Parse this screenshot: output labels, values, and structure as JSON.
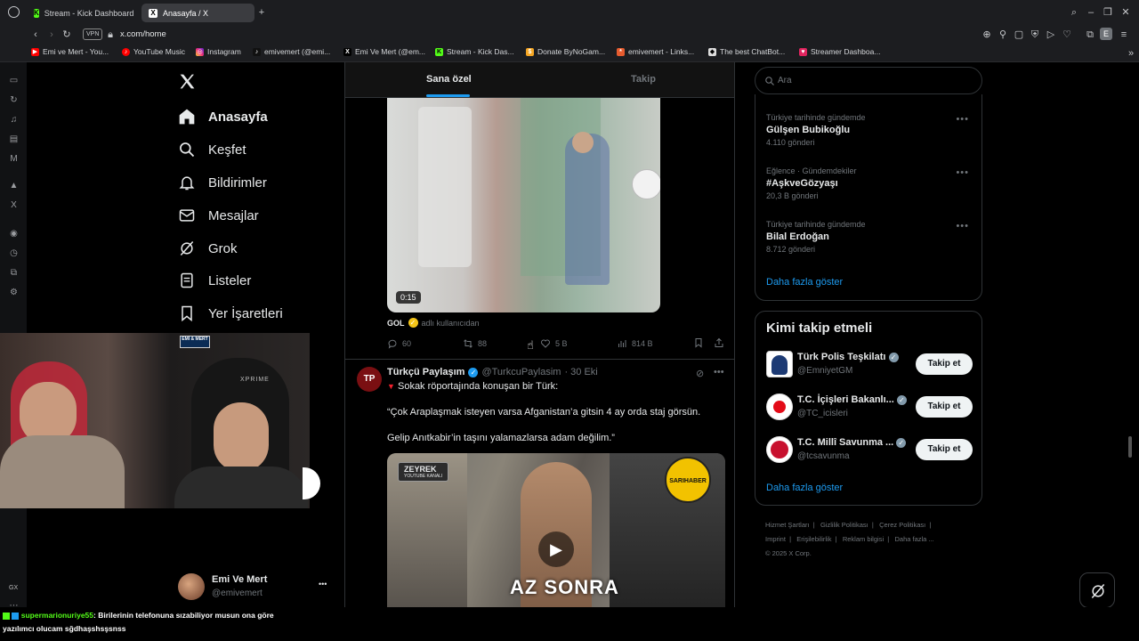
{
  "browser": {
    "tabs": [
      {
        "label": "Stream - Kick Dashboard",
        "active": false,
        "icon": "kick-icon"
      },
      {
        "label": "Anasayfa / X",
        "active": true,
        "icon": "x-icon"
      }
    ],
    "vpn_badge": "VPN",
    "url": "x.com/home",
    "profile_initial": "E",
    "bookmarks": [
      {
        "label": "Emi ve Mert - You...",
        "icon": "youtube-icon"
      },
      {
        "label": "YouTube Music",
        "icon": "youtube-music-icon"
      },
      {
        "label": "Instagram",
        "icon": "instagram-icon"
      },
      {
        "label": "emivemert (@emi...",
        "icon": "tiktok-icon"
      },
      {
        "label": "Emi Ve Mert (@em...",
        "icon": "x-icon"
      },
      {
        "label": "Stream - Kick Das...",
        "icon": "kick-icon"
      },
      {
        "label": "Donate ByNoGam...",
        "icon": "donate-icon"
      },
      {
        "label": "emivemert - Links...",
        "icon": "linktree-icon"
      },
      {
        "label": "The best ChatBot...",
        "icon": "chatbot-icon"
      },
      {
        "label": "Streamer Dashboa...",
        "icon": "dashboard-icon"
      }
    ],
    "rail_label": "GX"
  },
  "nav": {
    "items": [
      {
        "label": "Anasayfa",
        "icon": "home-icon",
        "active": true
      },
      {
        "label": "Keşfet",
        "icon": "search-icon",
        "active": false
      },
      {
        "label": "Bildirimler",
        "icon": "bell-icon",
        "active": false
      },
      {
        "label": "Mesajlar",
        "icon": "mail-icon",
        "active": false
      },
      {
        "label": "Grok",
        "icon": "grok-icon",
        "active": false
      },
      {
        "label": "Listeler",
        "icon": "list-icon",
        "active": false
      },
      {
        "label": "Yer İşaretleri",
        "icon": "bookmark-icon",
        "active": false
      }
    ],
    "account": {
      "name": "Emi Ve Mert",
      "handle": "@emivemert",
      "more": "•••"
    }
  },
  "feed": {
    "tabs": [
      "Sana özel",
      "Takip"
    ],
    "post1": {
      "duration": "0:15",
      "caption_user": "GOL",
      "caption_extra": "adlı kullanıcıdan",
      "replies": "60",
      "reposts": "88",
      "likes": "5 B",
      "views": "814 B"
    },
    "post2": {
      "name": "Türkçü Paylaşım",
      "handle": "@TurkcuPaylasim",
      "date": "· 30 Eki",
      "line1": "Sokak röportajında konuşan bir Türk:",
      "line2": "“Çok Araplaşmak isteyen varsa Afganistan’a gitsin 4 ay orda staj görsün.",
      "line3": "Gelip Anıtkabir’in taşını yalamazlarsa adam değilim.”",
      "video_badge": "ZEYREK",
      "video_badge_sub": "YOUTUBE KANALI",
      "video_logo": "SARIHABER",
      "video_overlay": "AZ SONRA"
    }
  },
  "sidebar": {
    "search_placeholder": "Ara",
    "trends": [
      {
        "category": "Türkiye tarihinde gündemde",
        "name": "Gülşen Bubikoğlu",
        "count": "4.110 gönderi"
      },
      {
        "category": "Eğlence · Gündemdekiler",
        "name": "#AşkveGözyaşı",
        "count": "20,3 B gönderi"
      },
      {
        "category": "Türkiye tarihinde gündemde",
        "name": "Bilal Erdoğan",
        "count": "8.712 gönderi"
      }
    ],
    "trends_more": "Daha fazla göster",
    "who_to_follow_title": "Kimi takip etmeli",
    "suggestions": [
      {
        "name": "Türk Polis Teşkilatı",
        "handle": "@EmniyetGM",
        "button": "Takip et"
      },
      {
        "name": "T.C. İçişleri Bakanlı...",
        "handle": "@TC_icisleri",
        "button": "Takip et"
      },
      {
        "name": "T.C. Millî Savunma ...",
        "handle": "@tcsavunma",
        "button": "Takip et"
      }
    ],
    "follow_more": "Daha fazla göster",
    "footer": [
      "Hizmet Şartları",
      "Gizlilik Politikası",
      "Çerez Politikası",
      "Imprint",
      "Erişilebilirlik",
      "Reklam bilgisi",
      "Daha fazla ...",
      "© 2025 X Corp."
    ]
  },
  "overlay": {
    "webcam_badge": "EMİ & MERT",
    "chair_brand": "XPRIME",
    "chat_user": "supermarionuriye55",
    "chat_message": ": Birilerinin telefonuna sızabiliyor musun ona göre",
    "chat_message2": "yazılımcı olucam sğdhaşshsşsnss"
  },
  "colors": {
    "accent": "#1d9bf0",
    "background": "#000000",
    "kick_green": "#53fc18"
  }
}
